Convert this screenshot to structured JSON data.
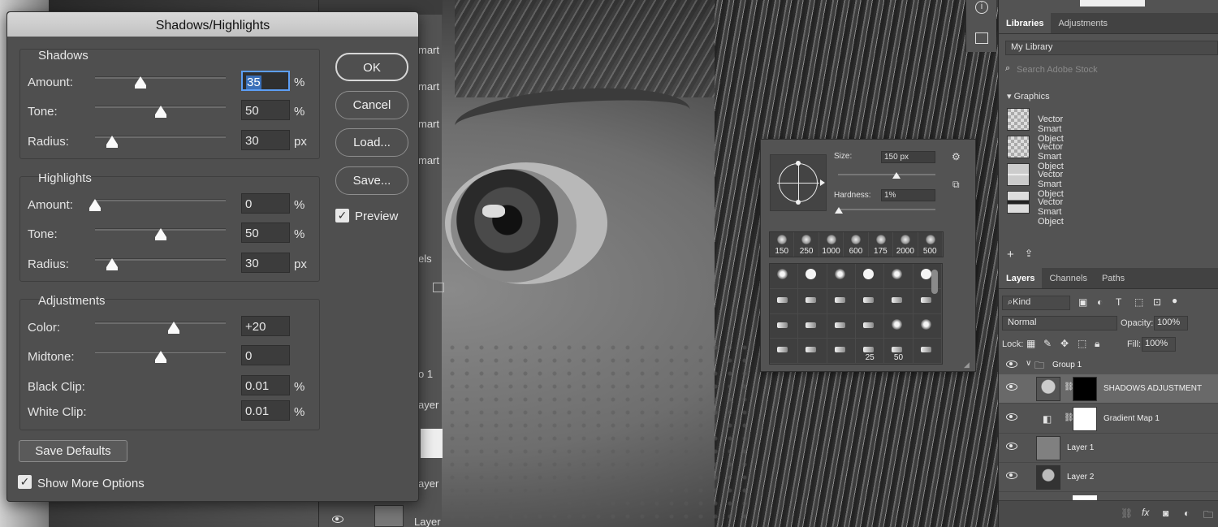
{
  "dialog": {
    "title": "Shadows/Highlights",
    "shadows": {
      "title": "Shadows",
      "rows": [
        {
          "label": "Amount:",
          "value": "35",
          "unit": "%",
          "level": 0.35
        },
        {
          "label": "Tone:",
          "value": "50",
          "unit": "%",
          "level": 0.5
        },
        {
          "label": "Radius:",
          "value": "30",
          "unit": "px",
          "level": 0.13
        }
      ]
    },
    "highlights": {
      "title": "Highlights",
      "rows": [
        {
          "label": "Amount:",
          "value": "0",
          "unit": "%",
          "level": 0.0
        },
        {
          "label": "Tone:",
          "value": "50",
          "unit": "%",
          "level": 0.5
        },
        {
          "label": "Radius:",
          "value": "30",
          "unit": "px",
          "level": 0.13
        }
      ]
    },
    "adjustments": {
      "title": "Adjustments",
      "rows": [
        {
          "label": "Color:",
          "value": "+20",
          "unit": "",
          "level": 0.6
        },
        {
          "label": "Midtone:",
          "value": "0",
          "unit": "",
          "level": 0.5
        },
        {
          "label": "Black Clip:",
          "value": "0.01",
          "unit": "%"
        },
        {
          "label": "White Clip:",
          "value": "0.01",
          "unit": "%"
        }
      ]
    },
    "buttons": {
      "ok": "OK",
      "cancel": "Cancel",
      "load": "Load...",
      "save": "Save..."
    },
    "preview_label": "Preview",
    "save_defaults": "Save Defaults",
    "show_more_options": "Show More Options"
  },
  "behind_panel_fragments": [
    "mart",
    "mart",
    "mart",
    "mart",
    "els",
    "o 1",
    "ayer",
    "ayer",
    "Layer"
  ],
  "brush_picker": {
    "size_label": "Size:",
    "size_value": "150 px",
    "size_level": 0.6,
    "hardness_label": "Hardness:",
    "hardness_value": "1%",
    "hardness_level": 0.01,
    "presets": [
      "150",
      "250",
      "1000",
      "600",
      "175",
      "2000",
      "500"
    ],
    "grid_labels": [
      "25",
      "50"
    ]
  },
  "libraries": {
    "tabs": [
      "Libraries",
      "Adjustments"
    ],
    "library_name": "My Library",
    "search_placeholder": "Search Adobe Stock",
    "section": "Graphics",
    "items": [
      "Vector Smart Object",
      "Vector Smart Object",
      "Vector Smart Object",
      "Vector Smart Object"
    ]
  },
  "layers": {
    "tabs": [
      "Layers",
      "Channels",
      "Paths"
    ],
    "kind_filter": "Kind",
    "blend_mode": "Normal",
    "opacity_label": "Opacity:",
    "opacity_value": "100%",
    "lock_label": "Lock:",
    "fill_label": "Fill:",
    "fill_value": "100%",
    "rows": [
      "Group 1",
      "SHADOWS ADJUSTMENT",
      "Gradient Map 1",
      "Layer 1",
      "Layer 2"
    ]
  },
  "colors": {
    "selection_blue": "#3a6fb8",
    "panel_bg": "#535353",
    "dialog_bg": "#4f4f4f"
  }
}
